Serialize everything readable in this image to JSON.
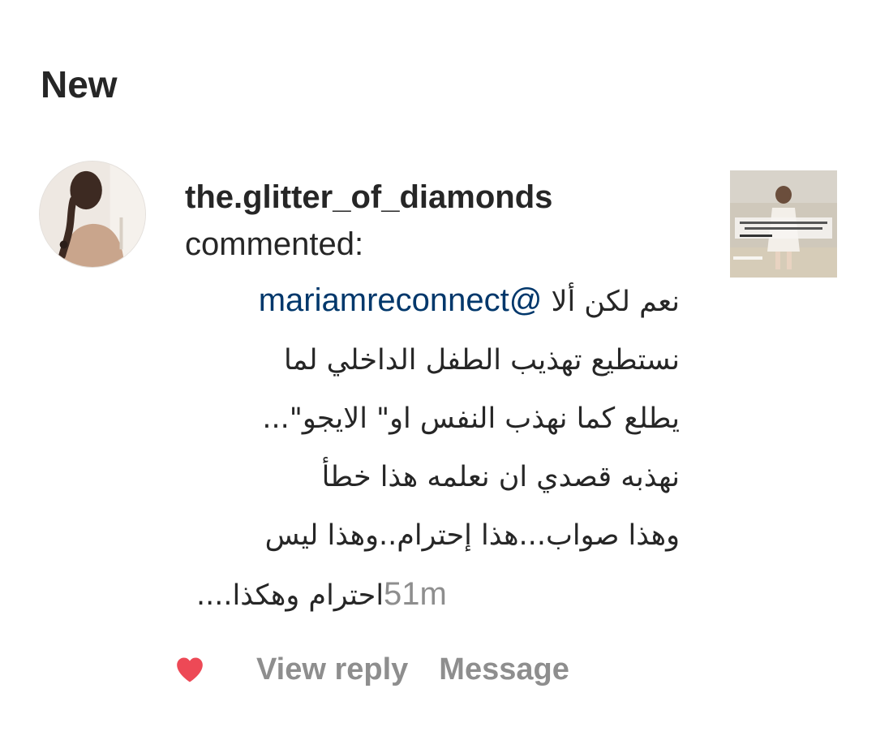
{
  "section": {
    "title": "New"
  },
  "notification": {
    "username": "the.glitter_of_diamonds",
    "action": "commented:",
    "comment": {
      "line1_prefix": "نعم لكن ألا",
      "mention": "@mariamreconnect",
      "line2": "نستطيع تهذيب  الطفل الداخلي لما",
      "line3": "يطلع كما نهذب النفس او\" الايجو\"...",
      "line4": "نهذبه قصدي ان نعلمه هذا خطأ",
      "line5": "وهذا صواب...هذا إحترام..وهذا ليس",
      "line6": "احترام وهكذا...."
    },
    "timestamp": "51m",
    "avatar_icon": "profile-photo-woman-braid",
    "thumbnail_icon": "post-thumbnail-child-beach"
  },
  "actions": {
    "like_icon": "heart-icon",
    "like_color": "#ed4956",
    "view_reply_label": "View reply",
    "message_label": "Message"
  },
  "colors": {
    "text": "#262626",
    "secondary": "#8e8e8e",
    "mention": "#00376b",
    "background": "#ffffff"
  }
}
